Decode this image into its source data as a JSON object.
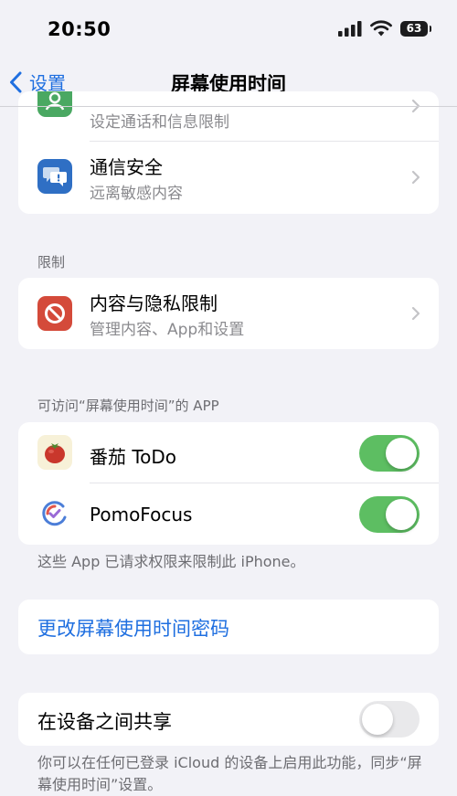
{
  "status": {
    "time": "20:50",
    "battery": "63"
  },
  "nav": {
    "back_label": "设置",
    "title": "屏幕使用时间"
  },
  "section_top": {
    "item0_subtitle": "设定通话和信息限制",
    "item1_title": "通信安全",
    "item1_subtitle": "远离敏感内容"
  },
  "restrictions": {
    "header": "限制",
    "title": "内容与隐私限制",
    "subtitle": "管理内容、App和设置"
  },
  "apps": {
    "header": "可访问“屏幕使用时间”的 APP",
    "items": [
      {
        "name": "番茄 ToDo",
        "enabled": true
      },
      {
        "name": "PomoFocus",
        "enabled": true
      }
    ],
    "footer": "这些 App 已请求权限来限制此 iPhone。"
  },
  "passcode": {
    "label": "更改屏幕使用时间密码"
  },
  "share": {
    "label": "在设备之间共享",
    "enabled": false,
    "footer": "你可以在任何已登录 iCloud 的设备上启用此功能，同步“屏幕使用时间”设置。"
  },
  "colors": {
    "accent": "#1f6fe0",
    "toggle_on": "#5dbe62",
    "communication_icon": "#4aa862",
    "safety_icon": "#2f6fc4",
    "restriction_icon": "#d44a3a"
  },
  "icons": [
    "cellular-signal-icon",
    "wifi-icon",
    "battery-icon",
    "chevron-left-icon",
    "chevron-right-icon",
    "communication-limits-icon",
    "communication-safety-icon",
    "restriction-icon",
    "tomato-app-icon",
    "pomofocus-app-icon"
  ]
}
